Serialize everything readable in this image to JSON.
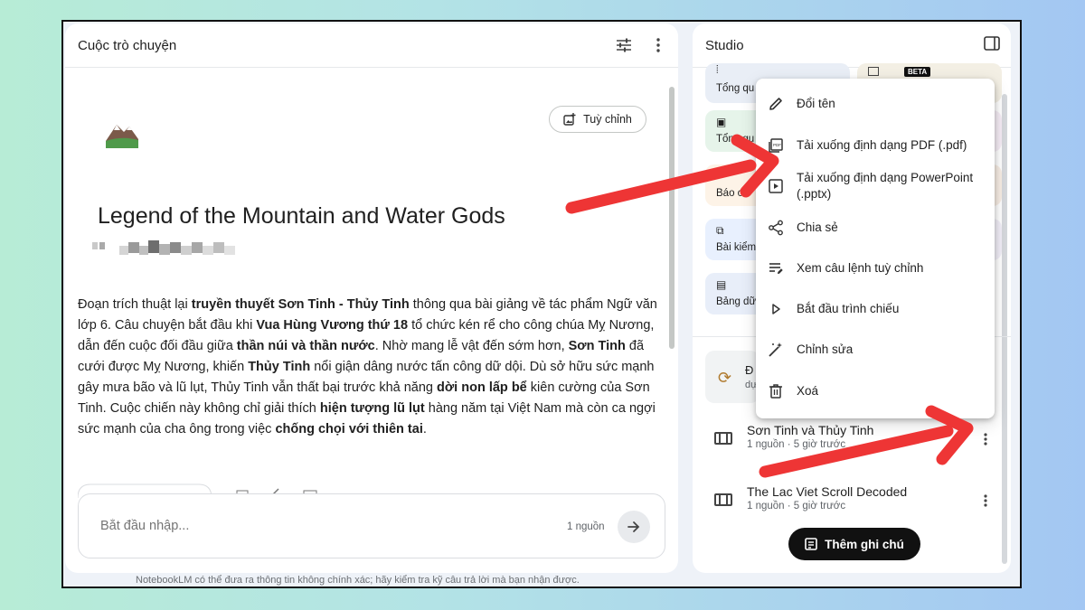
{
  "chat": {
    "title": "Cuộc trò chuyện",
    "customize_label": "Tuỳ chỉnh",
    "doc_title": "Legend of the Mountain and Water Gods",
    "summary_segments": [
      {
        "t": "Đoạn trích thuật lại ",
        "b": false
      },
      {
        "t": "truyền thuyết Sơn Tinh - Thủy Tinh",
        "b": true
      },
      {
        "t": " thông qua bài giảng về tác phẩm Ngữ văn lớp 6. Câu chuyện bắt đầu khi ",
        "b": false
      },
      {
        "t": "Vua Hùng Vương thứ 18",
        "b": true
      },
      {
        "t": " tổ chức kén rể cho công chúa Mỵ Nương, dẫn đến cuộc đối đầu giữa ",
        "b": false
      },
      {
        "t": "thần núi và thần nước",
        "b": true
      },
      {
        "t": ". Nhờ mang lễ vật đến sớm hơn, ",
        "b": false
      },
      {
        "t": "Sơn Tinh",
        "b": true
      },
      {
        "t": " đã cưới được Mỵ Nương, khiến ",
        "b": false
      },
      {
        "t": "Thủy Tinh",
        "b": true
      },
      {
        "t": " nổi giận dâng nước tấn công dữ dội. Dù sở hữu sức mạnh gây mưa bão và lũ lụt, Thủy Tinh vẫn thất bại trước khả năng ",
        "b": false
      },
      {
        "t": "dời non lấp bể",
        "b": true
      },
      {
        "t": " kiên cường của Sơn Tinh. Cuộc chiến này không chỉ giải thích ",
        "b": false
      },
      {
        "t": "hiện tượng lũ lụt",
        "b": true
      },
      {
        "t": " hàng năm tại Việt Nam mà còn ca ngợi sức mạnh của cha ông trong việc ",
        "b": false
      },
      {
        "t": "chống chọi với thiên tai",
        "b": true
      },
      {
        "t": ".",
        "b": false
      }
    ],
    "input_placeholder": "Bắt đầu nhập...",
    "source_count": "1 nguồn",
    "disclaimer": "NotebookLM có thể đưa ra thông tin không chính xác; hãy kiểm tra kỹ câu trả lời mà bạn nhận được."
  },
  "studio": {
    "title": "Studio",
    "tiles": [
      {
        "label": "Tổng qu",
        "color": "#e9eef6"
      },
      {
        "label": "Tổng qu",
        "color": "#e6f4ea"
      },
      {
        "label": "Báo cá",
        "color": "#fdf3e7"
      },
      {
        "label": "Bài kiểm",
        "color": "#e8f0fe"
      },
      {
        "label": "Bảng dữ",
        "color": "#e8eef9"
      }
    ],
    "beta_badge": "BETA",
    "generating_label": "Đ",
    "generating_sub": "dự",
    "notes": [
      {
        "title": "Sơn Tinh và Thủy Tinh",
        "meta": "1 nguồn · 5 giờ trước"
      },
      {
        "title": "The Lac Viet Scroll Decoded",
        "meta": "1 nguồn · 5 giờ trước"
      }
    ],
    "add_note_label": "Thêm ghi chú"
  },
  "menu": {
    "items": [
      {
        "label": "Đổi tên",
        "icon": "pencil-icon"
      },
      {
        "label": "Tải xuống định dạng PDF (.pdf)",
        "icon": "pdf-icon"
      },
      {
        "label": "Tải xuống định dạng PowerPoint (.pptx)",
        "icon": "slides-icon"
      },
      {
        "label": "Chia sẻ",
        "icon": "share-icon"
      },
      {
        "label": "Xem câu lệnh tuỳ chỉnh",
        "icon": "prompt-icon"
      },
      {
        "label": "Bắt đầu trình chiếu",
        "icon": "play-icon"
      },
      {
        "label": "Chỉnh sửa",
        "icon": "magic-edit-icon"
      },
      {
        "label": "Xoá",
        "icon": "trash-icon"
      }
    ]
  },
  "colors": {
    "arrow": "#ee3535",
    "add_note_bg": "#111111"
  }
}
